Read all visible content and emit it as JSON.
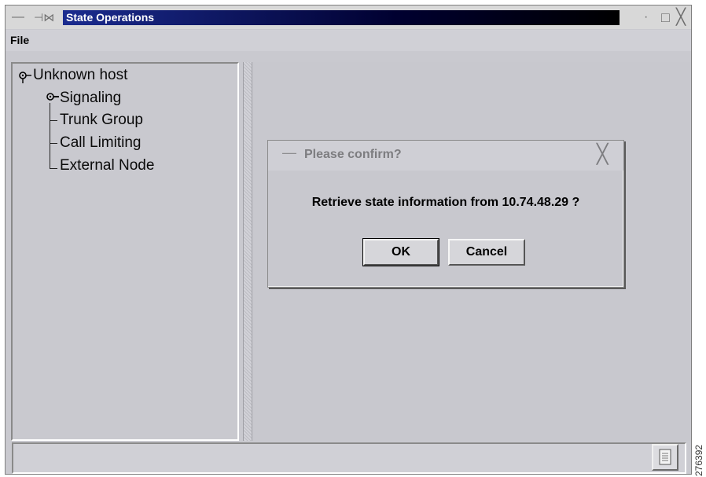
{
  "window": {
    "title": "State Operations",
    "controls": {
      "menu_glyph": "—",
      "pin_glyph": "⊣⋈",
      "min_glyph": "·",
      "max_glyph": "□",
      "close_glyph": "╳"
    }
  },
  "menubar": {
    "items": [
      {
        "label": "File"
      }
    ]
  },
  "tree": {
    "root": {
      "label": "Unknown host",
      "icon": "tree-node-icon"
    },
    "children": [
      {
        "label": "Signaling",
        "icon": "tree-node-icon"
      },
      {
        "label": "Trunk Group"
      },
      {
        "label": "Call Limiting"
      },
      {
        "label": "External Node"
      }
    ]
  },
  "dialog": {
    "title": "Please confirm?",
    "message": "Retrieve state information from 10.74.48.29 ?",
    "ok_label": "OK",
    "cancel_label": "Cancel",
    "close_glyph": "╳",
    "min_glyph": "—"
  },
  "statusbar": {
    "button_icon": "document-icon"
  },
  "side_label": "276392"
}
